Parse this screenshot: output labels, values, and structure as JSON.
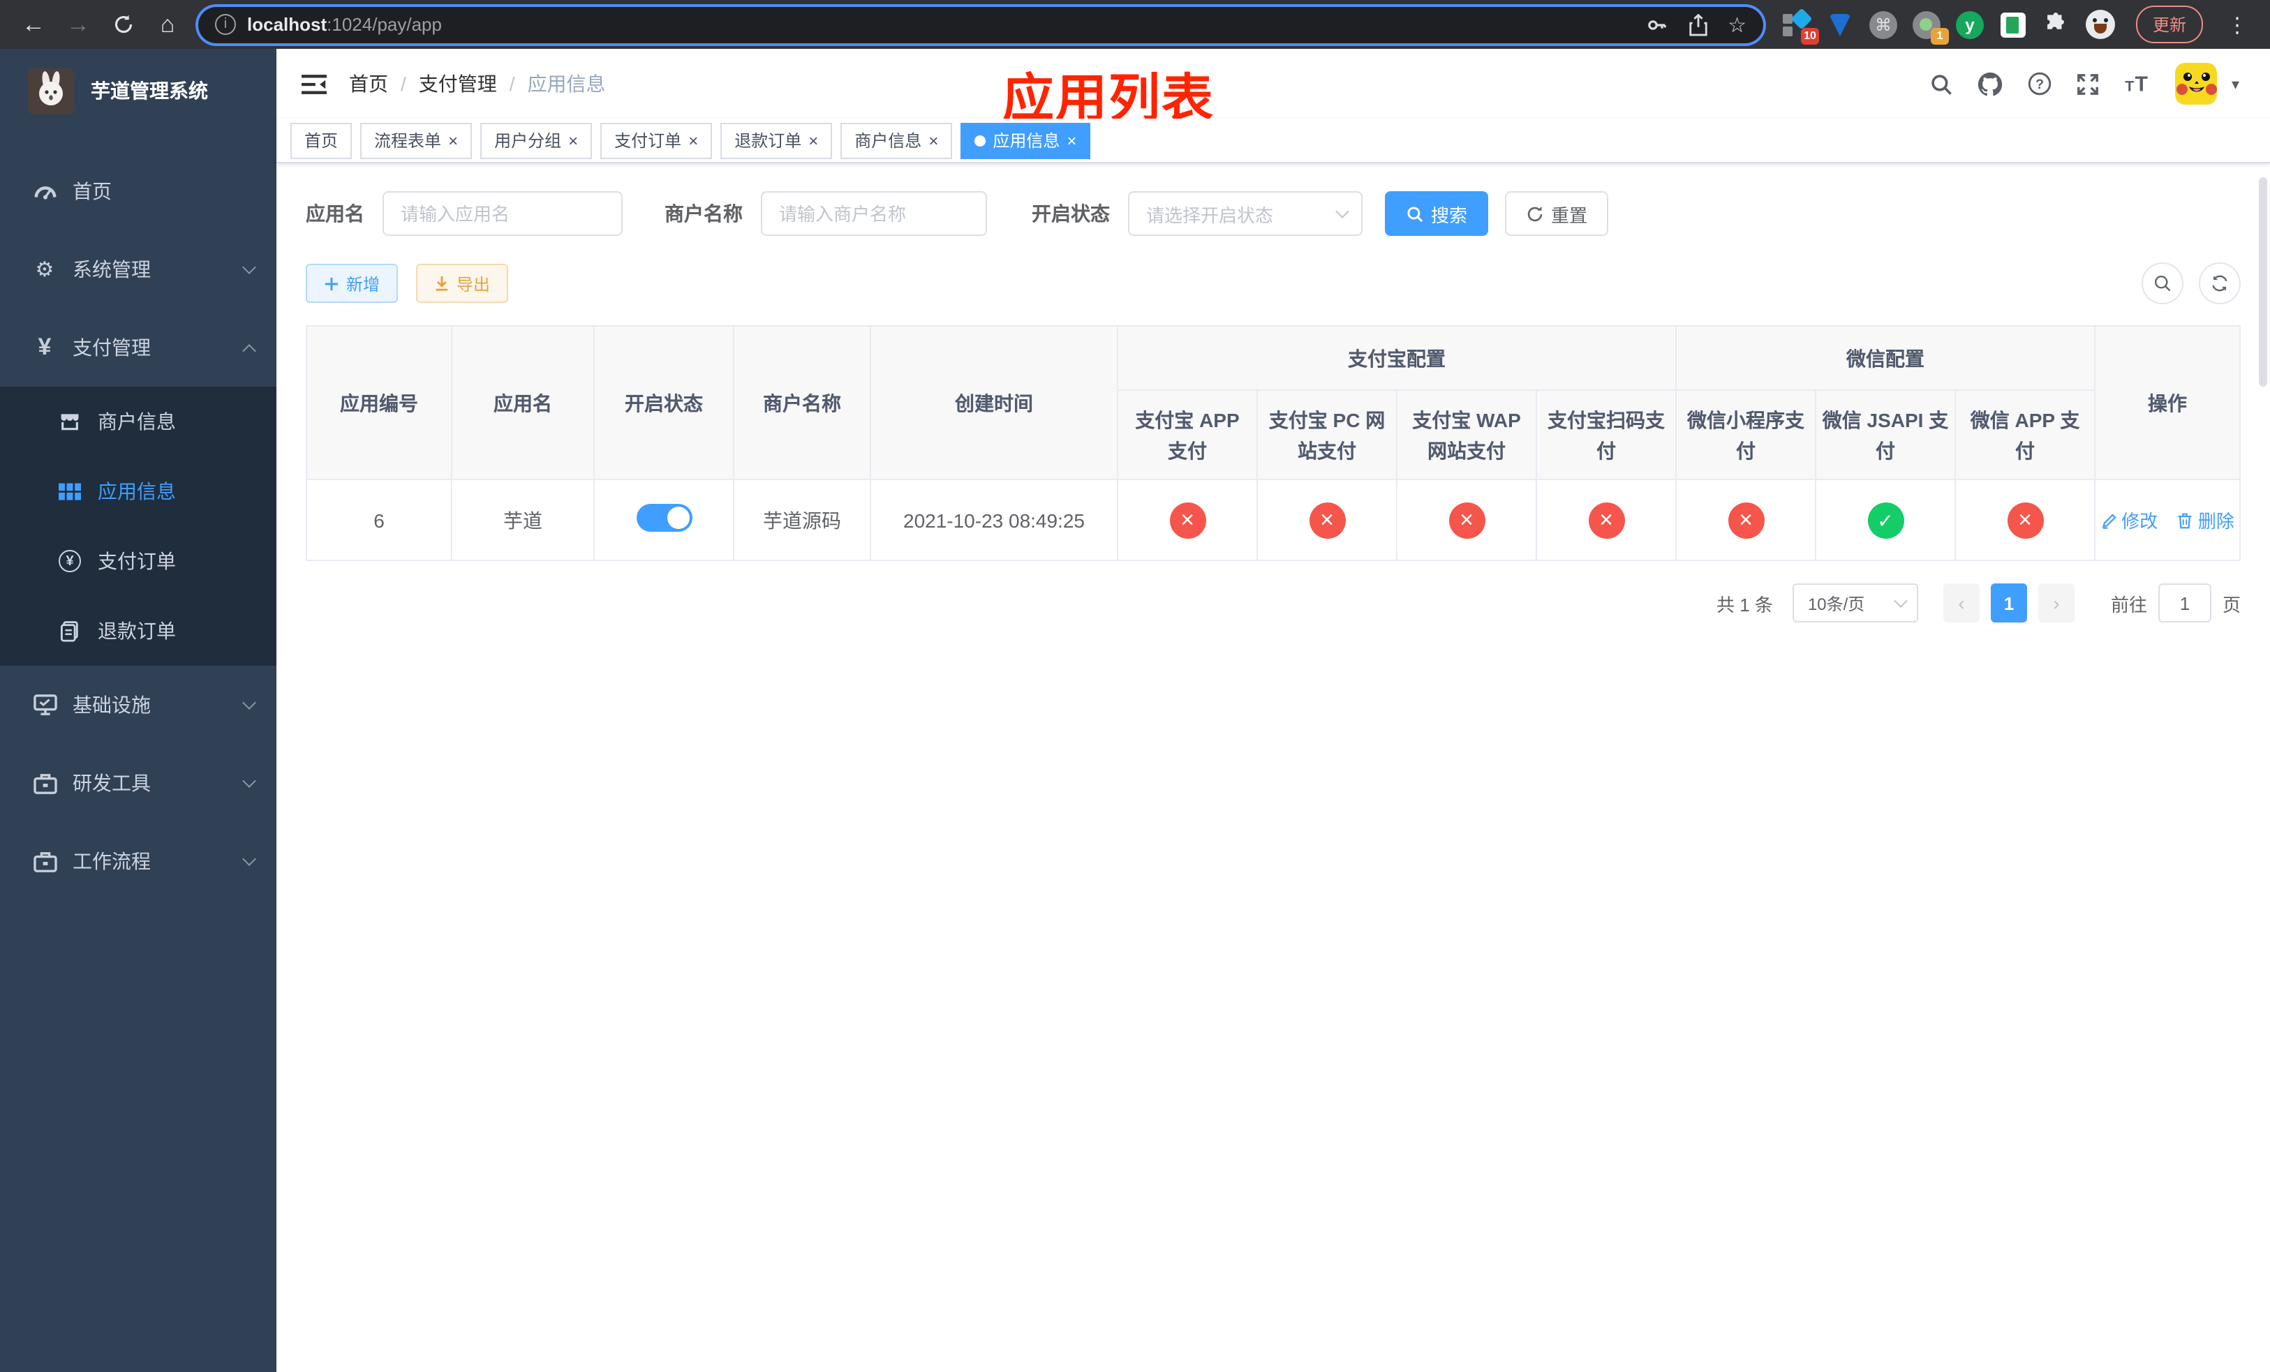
{
  "browser": {
    "url": {
      "host": "localhost",
      "rest": ":1024/pay/app"
    },
    "info_glyph": "i",
    "star_glyph": "☆",
    "command_glyph": "⌘",
    "ext_y_glyph": "y",
    "badge_ten": "10",
    "badge_one": "1",
    "update_label": "更新",
    "kebab_glyph": "⋮",
    "back_glyph": "←",
    "forward_glyph": "→",
    "home_glyph": "⌂"
  },
  "sidebar": {
    "title": "芋道管理系统",
    "items": [
      {
        "label": "首页"
      },
      {
        "label": "系统管理"
      },
      {
        "label": "支付管理"
      },
      {
        "label": "基础设施"
      },
      {
        "label": "研发工具"
      },
      {
        "label": "工作流程"
      }
    ],
    "submenu": [
      {
        "label": "商户信息"
      },
      {
        "label": "应用信息"
      },
      {
        "label": "支付订单"
      },
      {
        "label": "退款订单"
      }
    ],
    "yen_glyph": "¥",
    "gear_glyph": "⚙"
  },
  "header": {
    "breadcrumb": [
      "首页",
      "支付管理",
      "应用信息"
    ],
    "separator": "/",
    "annotation": "应用列表",
    "caret_glyph": "▾",
    "help_glyph": "?"
  },
  "tabs": [
    {
      "label": "首页"
    },
    {
      "label": "流程表单"
    },
    {
      "label": "用户分组"
    },
    {
      "label": "支付订单"
    },
    {
      "label": "退款订单"
    },
    {
      "label": "商户信息"
    },
    {
      "label": "应用信息"
    }
  ],
  "tab_close_glyph": "×",
  "filters": {
    "app_name_label": "应用名",
    "app_name_placeholder": "请输入应用名",
    "merchant_label": "商户名称",
    "merchant_placeholder": "请输入商户名称",
    "status_label": "开启状态",
    "status_placeholder": "请选择开启状态",
    "search_label": "搜索",
    "reset_label": "重置"
  },
  "toolbar": {
    "add_label": "新增",
    "export_label": "导出"
  },
  "table": {
    "columns": [
      "应用编号",
      "应用名",
      "开启状态",
      "商户名称",
      "创建时间"
    ],
    "group_alipay": "支付宝配置",
    "alipay_cols": [
      "支付宝 APP 支付",
      "支付宝 PC 网站支付",
      "支付宝 WAP 网站支付",
      "支付宝扫码支付"
    ],
    "group_wechat": "微信配置",
    "wechat_cols": [
      "微信小程序支付",
      "微信 JSAPI 支付",
      "微信 APP 支付"
    ],
    "ops_col": "操作",
    "rows": [
      {
        "app_id": "6",
        "app_name": "芋道",
        "enabled": true,
        "merchant_name": "芋道源码",
        "create_time": "2021-10-23 08:49:25",
        "statuses": [
          "x",
          "x",
          "x",
          "x",
          "x",
          "check",
          "x"
        ],
        "op_edit": "修改",
        "op_delete": "删除"
      }
    ]
  },
  "pagination": {
    "total": "共 1 条",
    "page_size": "10条/页",
    "prev_glyph": "‹",
    "next_glyph": "›",
    "page": "1",
    "goto_label": "前往",
    "goto_value": "1",
    "unit": "页"
  }
}
